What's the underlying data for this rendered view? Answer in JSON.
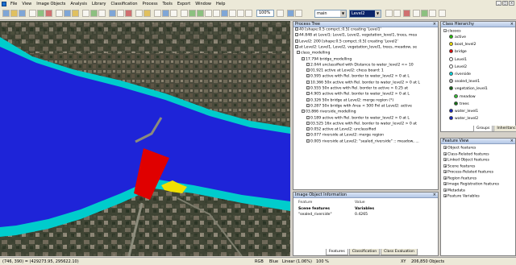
{
  "menubar": {
    "items": [
      "File",
      "View",
      "Image Objects",
      "Analysis",
      "Library",
      "Classification",
      "Process",
      "Tools",
      "Export",
      "Window",
      "Help"
    ]
  },
  "toolbar": {
    "zoom": "100%",
    "map_select": "main",
    "level_select": "Level2"
  },
  "process_tree": {
    "title": "Process Tree",
    "rows": [
      "40 [shape:0.5 compct.:0.5] creating 'Level1'",
      "44.848  at Level1: Level1, Level2, vegetation_level1, trees, mea",
      "Level2: 200 [shape:0.5 compct.:0.5] creating 'Level2'",
      "at Level2: Level1, Level2, vegetation_level1, trees, meadow, se",
      "class_modelling",
      "17.794   bridge_modelling",
      "2.044   unclassified with Distance to water_level2 <= 10",
      "01.921   active at  Level2: chess board: 1",
      "0.595   active with Rel. border to water_level2 > 0  at  L",
      "10.366   50x active with Rel. border to water_level2 > 0  at  L",
      "0.555   50x active with Rel. border to active > 0.25  at",
      "4.905   active with Rel. border to water_level2 > 0  at  L",
      "0.326   50x bridge at  Level2: merge region (*)",
      "0.287   50x bridge with Area < 500 Pxl at  Level2: active",
      "03.866   riverside_modelling",
      "0.189   active with Rel. border to water_level2 > 0  at  L",
      "03.525   16x active with Rel. border to water_level2 > 0  at",
      "0.052   active at  Level2: unclassified",
      "0.077   riverside at  Level2: merge region",
      "0.005   riverside at  Level2: \"sealed_riverside\" :: meadow, ..."
    ]
  },
  "class_hierarchy": {
    "title": "Class Hierarchy",
    "root": "classes",
    "items": [
      {
        "label": "active",
        "color": "#22c000"
      },
      {
        "label": "boot_level2",
        "color": "#f0e000"
      },
      {
        "label": "bridge",
        "color": "#e00000"
      },
      {
        "label": "Level1",
        "color": "#ffffff"
      },
      {
        "label": "Level2",
        "color": "#ffffff"
      },
      {
        "label": "riverside",
        "color": "#00d8e0"
      },
      {
        "label": "sealed_level1",
        "color": "#b8b8b8"
      },
      {
        "label": "vegetation_level1",
        "color": "#106010"
      },
      {
        "label": "meadow",
        "color": "#30c030"
      },
      {
        "label": "trees",
        "color": "#107010"
      },
      {
        "label": "water_level1",
        "color": "#1020c0"
      },
      {
        "label": "water_level2",
        "color": "#1020c0"
      }
    ],
    "tabs": [
      "Groups",
      "Inheritance"
    ]
  },
  "feature_view": {
    "title": "Feature View",
    "items": [
      "Object features",
      "Class-Related features",
      "Linked Object features",
      "Scene features",
      "Process-Related features",
      "Region features",
      "Image Registration features",
      "Metadata",
      "Feature Variables"
    ]
  },
  "image_object_info": {
    "title": "Image Object Information",
    "columns": [
      "Feature",
      "Value"
    ],
    "rows": [
      [
        "Scene features",
        "Variables"
      ],
      [
        "\"sealed_riverside\"",
        "0.4265"
      ]
    ],
    "tabs": [
      "Features",
      "Classification",
      "Class Evaluation"
    ]
  },
  "status": {
    "coords": "(746, 390) = (429273.95, 295622.10)",
    "mode": "RGB",
    "sep1": "Blue",
    "stretch": "Linear (1.06%)",
    "zoom": "100 %",
    "xy": "XY",
    "objects": "206,850 Objects"
  },
  "colors": {
    "river": "#1e24d8",
    "riverside": "#00cccc",
    "bridge": "#e00000",
    "boot": "#f0e000"
  }
}
